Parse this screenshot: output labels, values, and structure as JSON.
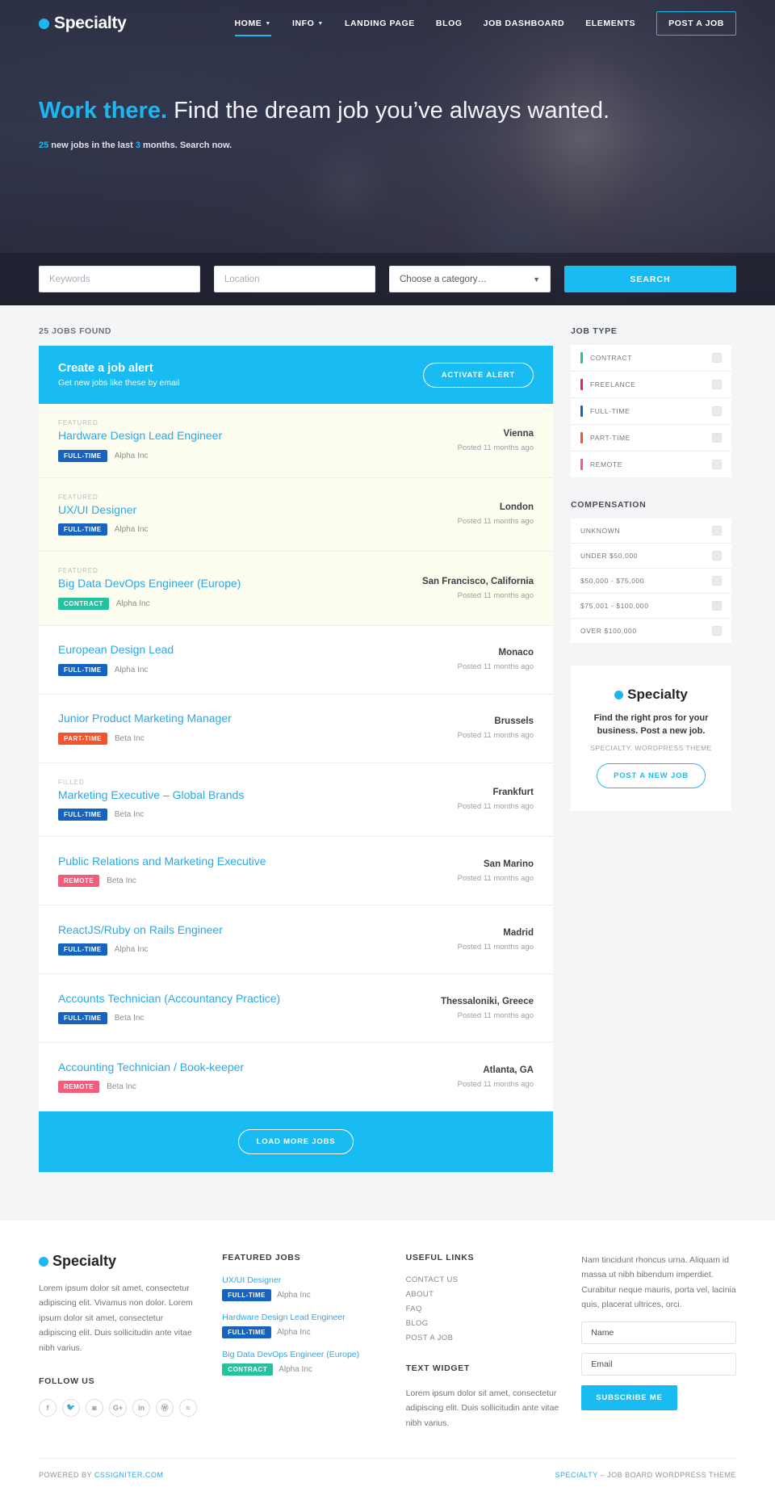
{
  "brand": {
    "name": "Specialty"
  },
  "nav": {
    "items": [
      {
        "label": "HOME",
        "caret": true,
        "active": true
      },
      {
        "label": "INFO",
        "caret": true,
        "active": false
      },
      {
        "label": "LANDING PAGE",
        "caret": false,
        "active": false
      },
      {
        "label": "BLOG",
        "caret": false,
        "active": false
      },
      {
        "label": "JOB DASHBOARD",
        "caret": false,
        "active": false
      },
      {
        "label": "ELEMENTS",
        "caret": false,
        "active": false
      }
    ],
    "cta": "POST A JOB"
  },
  "hero": {
    "title_strong": "Work there.",
    "title_rest": " Find the dream job you’ve always wanted.",
    "sub_count": "25",
    "sub_mid": " new jobs in the last ",
    "sub_months": "3",
    "sub_end": " months. Search now."
  },
  "search": {
    "keywords_placeholder": "Keywords",
    "location_placeholder": "Location",
    "category_value": "Choose a category…",
    "button": "SEARCH"
  },
  "results": {
    "count_label": "25 JOBS FOUND"
  },
  "alert": {
    "title": "Create a job alert",
    "subtitle": "Get new jobs like these by email",
    "button": "ACTIVATE ALERT"
  },
  "jobs": [
    {
      "flag": "FEATURED",
      "featured": true,
      "title": "Hardware Design Lead Engineer",
      "tag": "FULL-TIME",
      "tag_class": "full-time",
      "company": "Alpha Inc",
      "location": "Vienna",
      "posted": "Posted 11 months ago"
    },
    {
      "flag": "FEATURED",
      "featured": true,
      "title": "UX/UI Designer",
      "tag": "FULL-TIME",
      "tag_class": "full-time",
      "company": "Alpha Inc",
      "location": "London",
      "posted": "Posted 11 months ago"
    },
    {
      "flag": "FEATURED",
      "featured": true,
      "title": "Big Data DevOps Engineer (Europe)",
      "tag": "CONTRACT",
      "tag_class": "contract",
      "company": "Alpha Inc",
      "location": "San Francisco, California",
      "posted": "Posted 11 months ago"
    },
    {
      "flag": "",
      "featured": false,
      "title": "European Design Lead",
      "tag": "FULL-TIME",
      "tag_class": "full-time",
      "company": "Alpha Inc",
      "location": "Monaco",
      "posted": "Posted 11 months ago"
    },
    {
      "flag": "",
      "featured": false,
      "title": "Junior Product Marketing Manager",
      "tag": "PART-TIME",
      "tag_class": "part-time",
      "company": "Beta Inc",
      "location": "Brussels",
      "posted": "Posted 11 months ago"
    },
    {
      "flag": "FILLED",
      "featured": false,
      "title": "Marketing Executive – Global Brands",
      "tag": "FULL-TIME",
      "tag_class": "full-time",
      "company": "Beta Inc",
      "location": "Frankfurt",
      "posted": "Posted 11 months ago"
    },
    {
      "flag": "",
      "featured": false,
      "title": "Public Relations and Marketing Executive",
      "tag": "REMOTE",
      "tag_class": "remote",
      "company": "Beta Inc",
      "location": "San Marino",
      "posted": "Posted 11 months ago"
    },
    {
      "flag": "",
      "featured": false,
      "title": "ReactJS/Ruby on Rails Engineer",
      "tag": "FULL-TIME",
      "tag_class": "full-time",
      "company": "Alpha Inc",
      "location": "Madrid",
      "posted": "Posted 11 months ago"
    },
    {
      "flag": "",
      "featured": false,
      "title": "Accounts Technician (Accountancy Practice)",
      "tag": "FULL-TIME",
      "tag_class": "full-time",
      "company": "Beta Inc",
      "location": "Thessaloniki, Greece",
      "posted": "Posted 11 months ago"
    },
    {
      "flag": "",
      "featured": false,
      "title": "Accounting Technician / Book-keeper",
      "tag": "REMOTE",
      "tag_class": "remote",
      "company": "Beta Inc",
      "location": "Atlanta, GA",
      "posted": "Posted 11 months ago"
    }
  ],
  "load_more": "LOAD MORE JOBS",
  "sidebar": {
    "job_type_title": "JOB TYPE",
    "job_types": [
      {
        "label": "CONTRACT",
        "color": "#25c2a0",
        "checked": false
      },
      {
        "label": "FREELANCE",
        "color": "#e8216b",
        "checked": false
      },
      {
        "label": "FULL-TIME",
        "color": "#1763bd",
        "checked": false
      },
      {
        "label": "PART-TIME",
        "color": "#f2542d",
        "checked": false
      },
      {
        "label": "REMOTE",
        "color": "#ef5f7c",
        "checked": false
      }
    ],
    "compensation_title": "COMPENSATION",
    "compensation": [
      {
        "label": "UNKNOWN",
        "checked": false
      },
      {
        "label": "UNDER $50,000",
        "checked": false
      },
      {
        "label": "$50,000 - $75,000",
        "checked": false
      },
      {
        "label": "$75,001 - $100,000",
        "checked": false
      },
      {
        "label": "OVER $100,000",
        "checked": false
      }
    ],
    "promo": {
      "brand": "Specialty",
      "headline": "Find the right pros for your business. Post a new job.",
      "subtext": "SPECIALTY. WORDPRESS THEME",
      "button": "POST A NEW JOB"
    }
  },
  "footer": {
    "brand": "Specialty",
    "about": "Lorem ipsum dolor sit amet, consectetur adipiscing elit. Vivamus non dolor. Lorem ipsum dolor sit amet, consectetur adipiscing elit. Duis sollicitudin ante vitae nibh varius.",
    "follow_title": "FOLLOW US",
    "social": [
      {
        "name": "facebook-icon",
        "glyph": "f"
      },
      {
        "name": "twitter-icon",
        "glyph": "🐦"
      },
      {
        "name": "instagram-icon",
        "glyph": "◙"
      },
      {
        "name": "google-plus-icon",
        "glyph": "G+"
      },
      {
        "name": "linkedin-icon",
        "glyph": "in"
      },
      {
        "name": "wordpress-icon",
        "glyph": "Ⓦ"
      },
      {
        "name": "rss-icon",
        "glyph": "≈"
      }
    ],
    "featured_title": "FEATURED JOBS",
    "featured_jobs": [
      {
        "title": "UX/UI Designer",
        "tag": "FULL-TIME",
        "tag_class": "full-time",
        "company": "Alpha Inc"
      },
      {
        "title": "Hardware Design Lead Engineer",
        "tag": "FULL-TIME",
        "tag_class": "full-time",
        "company": "Alpha Inc"
      },
      {
        "title": "Big Data DevOps Engineer (Europe)",
        "tag": "CONTRACT",
        "tag_class": "contract",
        "company": "Alpha Inc"
      }
    ],
    "links_title": "USEFUL LINKS",
    "links": [
      "CONTACT US",
      "ABOUT",
      "FAQ",
      "BLOG",
      "POST A JOB"
    ],
    "text_widget_title": "TEXT WIDGET",
    "text_widget_body": "Lorem ipsum dolor sit amet, consectetur adipiscing elit. Duis sollicitudin ante vitae nibh varius.",
    "newsletter_text": "Nam tincidunt rhoncus urna. Aliquam id massa ut nibh bibendum imperdiet. Curabitur neque mauris, porta vel, lacinia quis, placerat ultrices, orci.",
    "name_placeholder": "Name",
    "email_placeholder": "Email",
    "subscribe_button": "SUBSCRIBE ME",
    "powered_prefix": "POWERED BY ",
    "powered_link": "CSSIGNITER.COM",
    "theme_link": "SPECIALTY",
    "theme_rest": " – JOB BOARD WORDPRESS THEME"
  }
}
